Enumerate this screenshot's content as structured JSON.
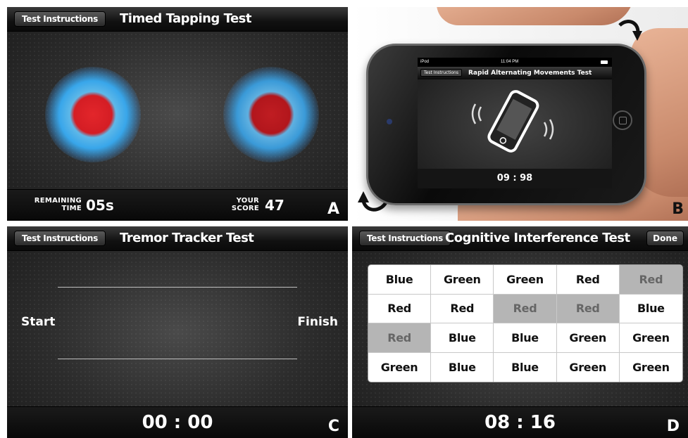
{
  "panel_a": {
    "instructions_label": "Test Instructions",
    "title": "Timed Tapping Test",
    "remaining_caption_1": "REMAINING",
    "remaining_caption_2": "TIME",
    "remaining_value": "05s",
    "score_caption_1": "YOUR",
    "score_caption_2": "SCORE",
    "score_value": "47",
    "letter": "A"
  },
  "panel_b": {
    "status_device": "iPod",
    "status_time": "11:04 PM",
    "instructions_label": "Test Instructions",
    "title": "Rapid Alternating Movements Test",
    "timer": "09 : 98",
    "letter": "B"
  },
  "panel_c": {
    "instructions_label": "Test Instructions",
    "title": "Tremor Tracker Test",
    "start_label": "Start",
    "finish_label": "Finish",
    "timer": "00 : 00",
    "letter": "C"
  },
  "panel_d": {
    "instructions_label": "Test Instructions",
    "title": "Cognitive Interference Test",
    "done_label": "Done",
    "grid": [
      [
        {
          "text": "Blue",
          "highlighted": false
        },
        {
          "text": "Green",
          "highlighted": false
        },
        {
          "text": "Green",
          "highlighted": false
        },
        {
          "text": "Red",
          "highlighted": false
        },
        {
          "text": "Red",
          "highlighted": true
        }
      ],
      [
        {
          "text": "Red",
          "highlighted": false
        },
        {
          "text": "Red",
          "highlighted": false
        },
        {
          "text": "Red",
          "highlighted": true
        },
        {
          "text": "Red",
          "highlighted": true
        },
        {
          "text": "Blue",
          "highlighted": false
        }
      ],
      [
        {
          "text": "Red",
          "highlighted": true
        },
        {
          "text": "Blue",
          "highlighted": false
        },
        {
          "text": "Blue",
          "highlighted": false
        },
        {
          "text": "Green",
          "highlighted": false
        },
        {
          "text": "Green",
          "highlighted": false
        }
      ],
      [
        {
          "text": "Green",
          "highlighted": false
        },
        {
          "text": "Blue",
          "highlighted": false
        },
        {
          "text": "Blue",
          "highlighted": false
        },
        {
          "text": "Green",
          "highlighted": false
        },
        {
          "text": "Green",
          "highlighted": false
        }
      ]
    ],
    "timer": "08 : 16",
    "letter": "D"
  },
  "colors": {
    "target_red": "#e3262b",
    "target_glow": "#38a6ea",
    "highlight_cell": "#b5b5b5"
  }
}
